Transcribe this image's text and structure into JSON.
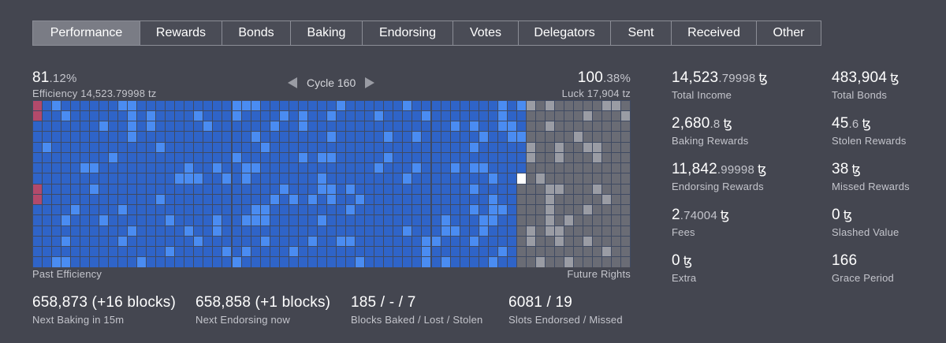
{
  "tabs": [
    "Performance",
    "Rewards",
    "Bonds",
    "Baking",
    "Endorsing",
    "Votes",
    "Delegators",
    "Sent",
    "Received",
    "Other"
  ],
  "active_tab": 0,
  "efficiency": {
    "int": "81",
    "dec": ".12%",
    "label": "Efficiency 14,523.79998 tz"
  },
  "cycle": {
    "label": "Cycle 160"
  },
  "luck": {
    "int": "100",
    "dec": ".38%",
    "label": "Luck 17,904 tz"
  },
  "grid": {
    "cols": 63,
    "rows": 16,
    "done_cells": 823,
    "current_cell": 823,
    "colors": {
      "past": "#2f64c8",
      "past_hi": "#4a8cf2",
      "missed": "#b24a6b",
      "future": "#6a6c75",
      "future_hi": "#9a9ca4",
      "current": "#ffffff",
      "gap": "#3f4a62"
    }
  },
  "past_label": "Past Efficiency",
  "future_label": "Future Rights",
  "bottom": [
    {
      "value": "658,873 (+16 blocks)",
      "label": "Next Baking in 15m"
    },
    {
      "value": "658,858 (+1 blocks)",
      "label": "Next Endorsing now"
    },
    {
      "value": "185 / - / 7",
      "label": "Blocks Baked / Lost / Stolen"
    },
    {
      "value": "6081 / 19",
      "label": "Slots Endorsed / Missed"
    }
  ],
  "stats_left": [
    {
      "int": "14,523",
      "dec": ".79998",
      "label": "Total Income"
    },
    {
      "int": "2,680",
      "dec": ".8",
      "label": "Baking Rewards"
    },
    {
      "int": "11,842",
      "dec": ".99998",
      "label": "Endorsing Rewards"
    },
    {
      "int": "2",
      "dec": ".74004",
      "label": "Fees"
    },
    {
      "int": "0",
      "dec": "",
      "label": "Extra"
    }
  ],
  "stats_right": [
    {
      "int": "483,904",
      "dec": "",
      "label": "Total Bonds"
    },
    {
      "int": "45",
      "dec": ".6",
      "label": "Stolen Rewards"
    },
    {
      "int": "38",
      "dec": "",
      "label": "Missed Rewards"
    },
    {
      "int": "0",
      "dec": "",
      "label": "Slashed Value"
    },
    {
      "int": "166",
      "dec": "",
      "label": "Grace Period",
      "no_symbol": true
    }
  ],
  "tez_symbol": "ꜩ"
}
